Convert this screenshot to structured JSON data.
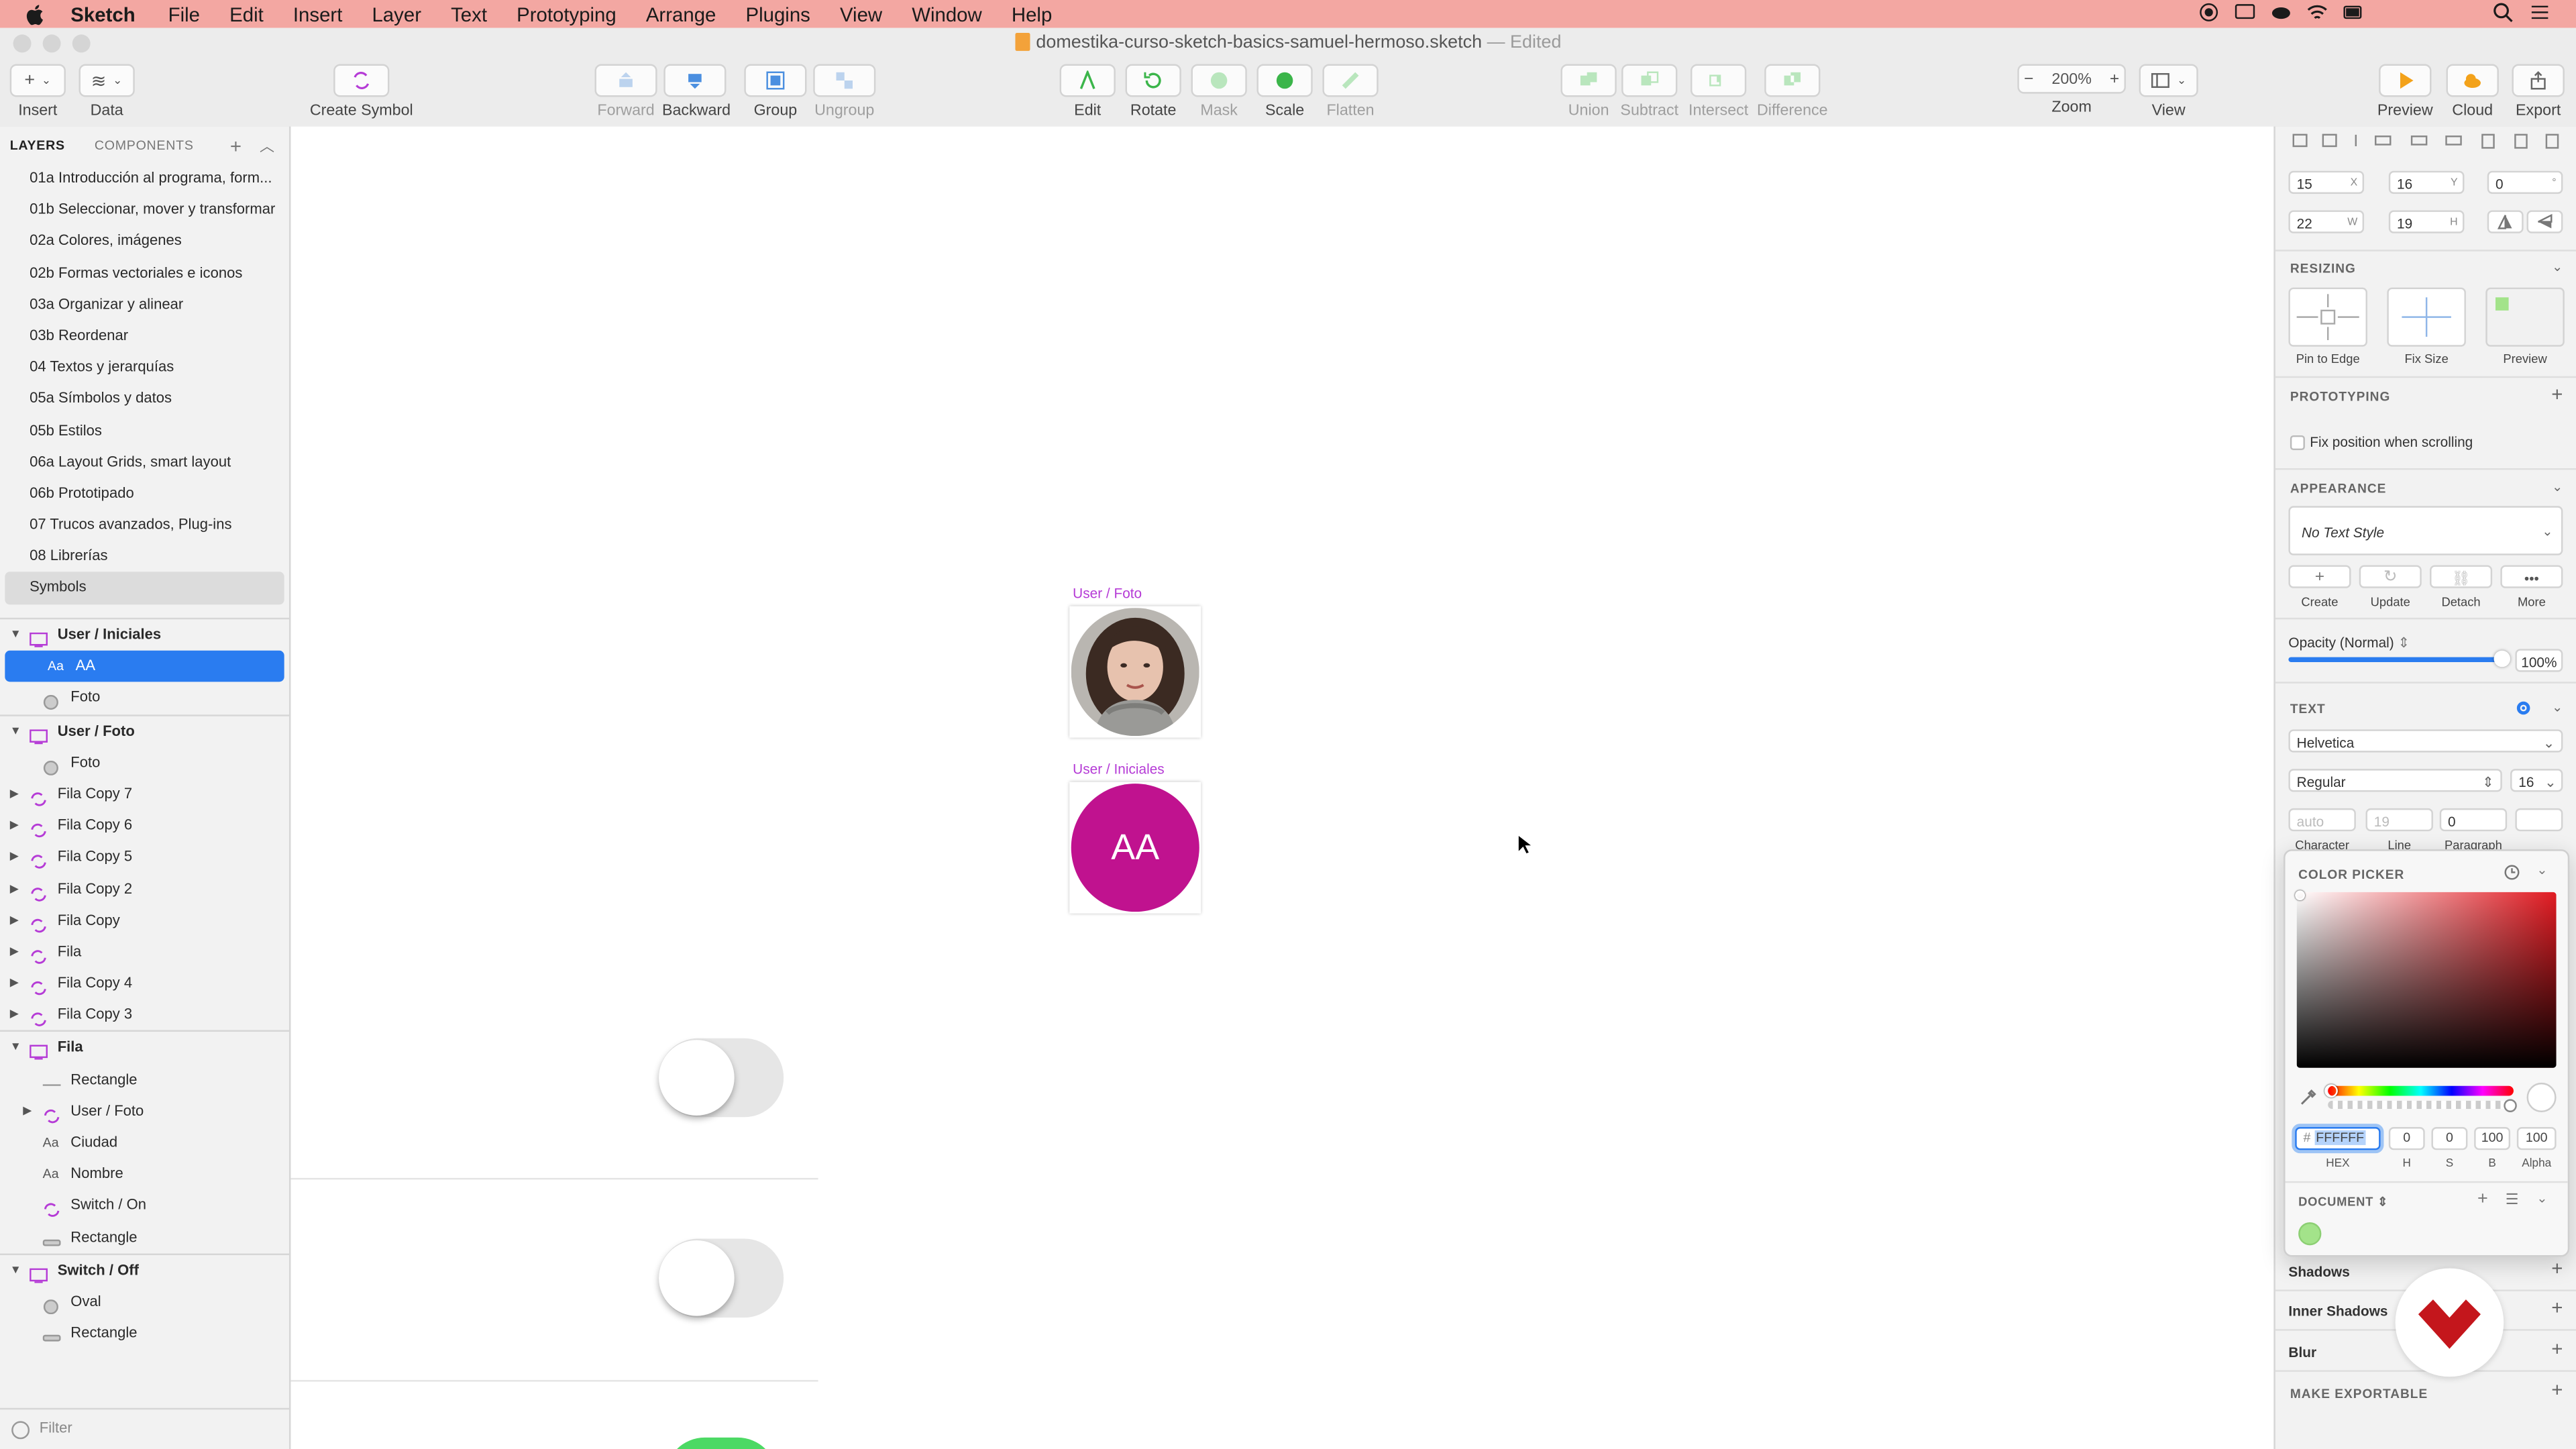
{
  "menubar": {
    "app_name": "Sketch",
    "items": [
      "File",
      "Edit",
      "Insert",
      "Layer",
      "Text",
      "Prototyping",
      "Arrange",
      "Plugins",
      "View",
      "Window",
      "Help"
    ]
  },
  "window": {
    "filename": "domestika-curso-sketch-basics-samuel-hermoso.sketch",
    "status": "— Edited"
  },
  "toolbar": {
    "insert": "Insert",
    "data": "Data",
    "create_symbol": "Create Symbol",
    "forward": "Forward",
    "backward": "Backward",
    "group": "Group",
    "ungroup": "Ungroup",
    "edit": "Edit",
    "rotate": "Rotate",
    "mask": "Mask",
    "scale": "Scale",
    "flatten": "Flatten",
    "union": "Union",
    "subtract": "Subtract",
    "intersect": "Intersect",
    "difference": "Difference",
    "zoom_value": "200%",
    "zoom": "Zoom",
    "view": "View",
    "preview": "Preview",
    "cloud": "Cloud",
    "export": "Export"
  },
  "sidebar": {
    "tab_layers": "LAYERS",
    "tab_components": "COMPONENTS",
    "pages": [
      "01a Introducción al programa, form...",
      "01b Seleccionar, mover y transformar",
      "02a Colores, imágenes",
      "02b Formas vectoriales e iconos",
      "03a Organizar y alinear",
      "03b Reordenar",
      "04 Textos y jerarquías",
      "05a Símbolos y datos",
      "05b Estilos",
      "06a Layout Grids, smart layout",
      "06b Prototipado",
      "07 Trucos avanzados, Plug-ins",
      "08 Librerías",
      "Symbols"
    ],
    "layers": [
      {
        "name": "User / Iniciales",
        "kind": "artboard",
        "level": 0
      },
      {
        "name": "AA",
        "kind": "text",
        "level": 1
      },
      {
        "name": "Foto",
        "kind": "oval",
        "level": 1
      },
      {
        "name": "User / Foto",
        "kind": "artboard",
        "level": 0
      },
      {
        "name": "Foto",
        "kind": "oval",
        "level": 1
      },
      {
        "name": "Fila Copy 7",
        "kind": "symbol",
        "level": 0
      },
      {
        "name": "Fila Copy 6",
        "kind": "symbol",
        "level": 0
      },
      {
        "name": "Fila Copy 5",
        "kind": "symbol",
        "level": 0
      },
      {
        "name": "Fila Copy 2",
        "kind": "symbol",
        "level": 0
      },
      {
        "name": "Fila Copy",
        "kind": "symbol",
        "level": 0
      },
      {
        "name": "Fila",
        "kind": "symbol",
        "level": 0
      },
      {
        "name": "Fila Copy 4",
        "kind": "symbol",
        "level": 0
      },
      {
        "name": "Fila Copy 3",
        "kind": "symbol",
        "level": 0
      },
      {
        "name": "Fila",
        "kind": "artboard",
        "level": 0
      },
      {
        "name": "Rectangle",
        "kind": "line",
        "level": 1
      },
      {
        "name": "User / Foto",
        "kind": "symbol",
        "level": 1
      },
      {
        "name": "Ciudad",
        "kind": "text",
        "level": 1
      },
      {
        "name": "Nombre",
        "kind": "text",
        "level": 1
      },
      {
        "name": "Switch / On",
        "kind": "symbol",
        "level": 1
      },
      {
        "name": "Rectangle",
        "kind": "rect",
        "level": 1
      },
      {
        "name": "Switch / Off",
        "kind": "artboard",
        "level": 0
      },
      {
        "name": "Oval",
        "kind": "oval",
        "level": 1
      },
      {
        "name": "Rectangle",
        "kind": "rect",
        "level": 1
      }
    ],
    "filter_placeholder": "Filter"
  },
  "canvas": {
    "artboard_foto_label": "User / Foto",
    "artboard_iniciales_label": "User / Iniciales",
    "initials": "AA",
    "initials_color": "#c0128f",
    "switch_on_color": "#4cd964"
  },
  "inspector": {
    "x": "15",
    "x_label": "X",
    "y": "16",
    "y_label": "Y",
    "rotation": "0",
    "rotation_label": "°",
    "w": "22",
    "w_label": "W",
    "h": "19",
    "h_label": "H",
    "resizing_title": "RESIZING",
    "pin_to_edge": "Pin to Edge",
    "fix_size": "Fix Size",
    "preview": "Preview",
    "prototyping_title": "PROTOTYPING",
    "fix_position": "Fix position when scrolling",
    "appearance_title": "APPEARANCE",
    "text_style": "No Text Style",
    "create": "Create",
    "update": "Update",
    "detach": "Detach",
    "more": "More",
    "opacity_label": "Opacity (Normal)",
    "opacity_value": "100%",
    "opacity_fraction": 1.0,
    "text_title": "TEXT",
    "font_family": "Helvetica",
    "font_weight": "Regular",
    "font_size": "16",
    "character_placeholder": "auto",
    "line_placeholder": "19",
    "paragraph_value": "0",
    "character_label": "Character",
    "line_label": "Line",
    "paragraph_label": "Paragraph",
    "shadows": "Shadows",
    "inner_shadows": "Inner Shadows",
    "blur": "Blur",
    "make_exportable": "MAKE EXPORTABLE"
  },
  "color_picker": {
    "title": "COLOR PICKER",
    "hex_prefix": "#",
    "hex": "FFFFFF",
    "h": "0",
    "s": "0",
    "b": "100",
    "alpha": "100",
    "hex_label": "HEX",
    "h_label": "H",
    "s_label": "S",
    "b_label": "B",
    "alpha_label": "Alpha",
    "document_label": "DOCUMENT",
    "document_swatch_color": "#a3e38a"
  }
}
